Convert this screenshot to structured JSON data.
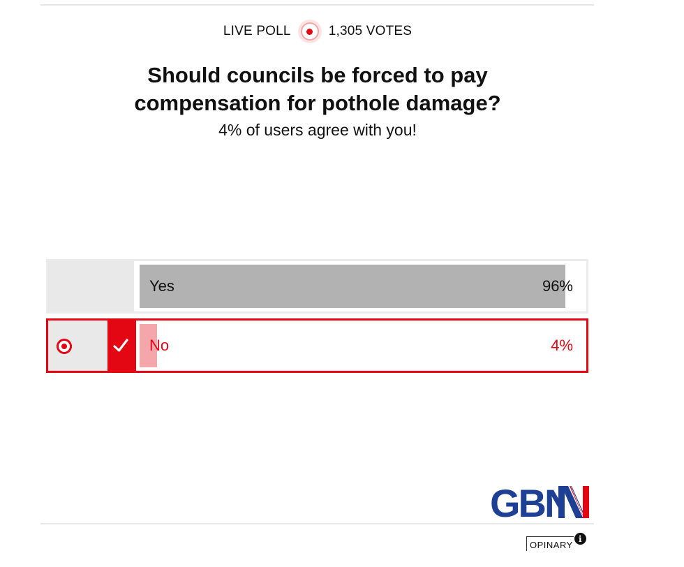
{
  "header": {
    "live_label": "LIVE POLL",
    "votes_label": "1,305 VOTES",
    "icon": "live-indicator-icon"
  },
  "question": {
    "line1": "Should councils be forced to pay",
    "line2": "compensation for pothole damage?"
  },
  "result_message": "4% of users agree with you!",
  "options": [
    {
      "label": "Yes",
      "percent_text": "96%",
      "percent": 96,
      "selected": false
    },
    {
      "label": "No",
      "percent_text": "4%",
      "percent": 4,
      "selected": true
    }
  ],
  "colors": {
    "accent": "#e30613",
    "bar_neutral": "#b2b2b2",
    "bar_selected": "#f4a6aa",
    "logo_blue": "#1d3f94"
  },
  "logo": {
    "text": "GBN",
    "icon": "gbn-logo"
  },
  "footer": {
    "brand": "OPINARY",
    "info_icon": "info-icon"
  }
}
